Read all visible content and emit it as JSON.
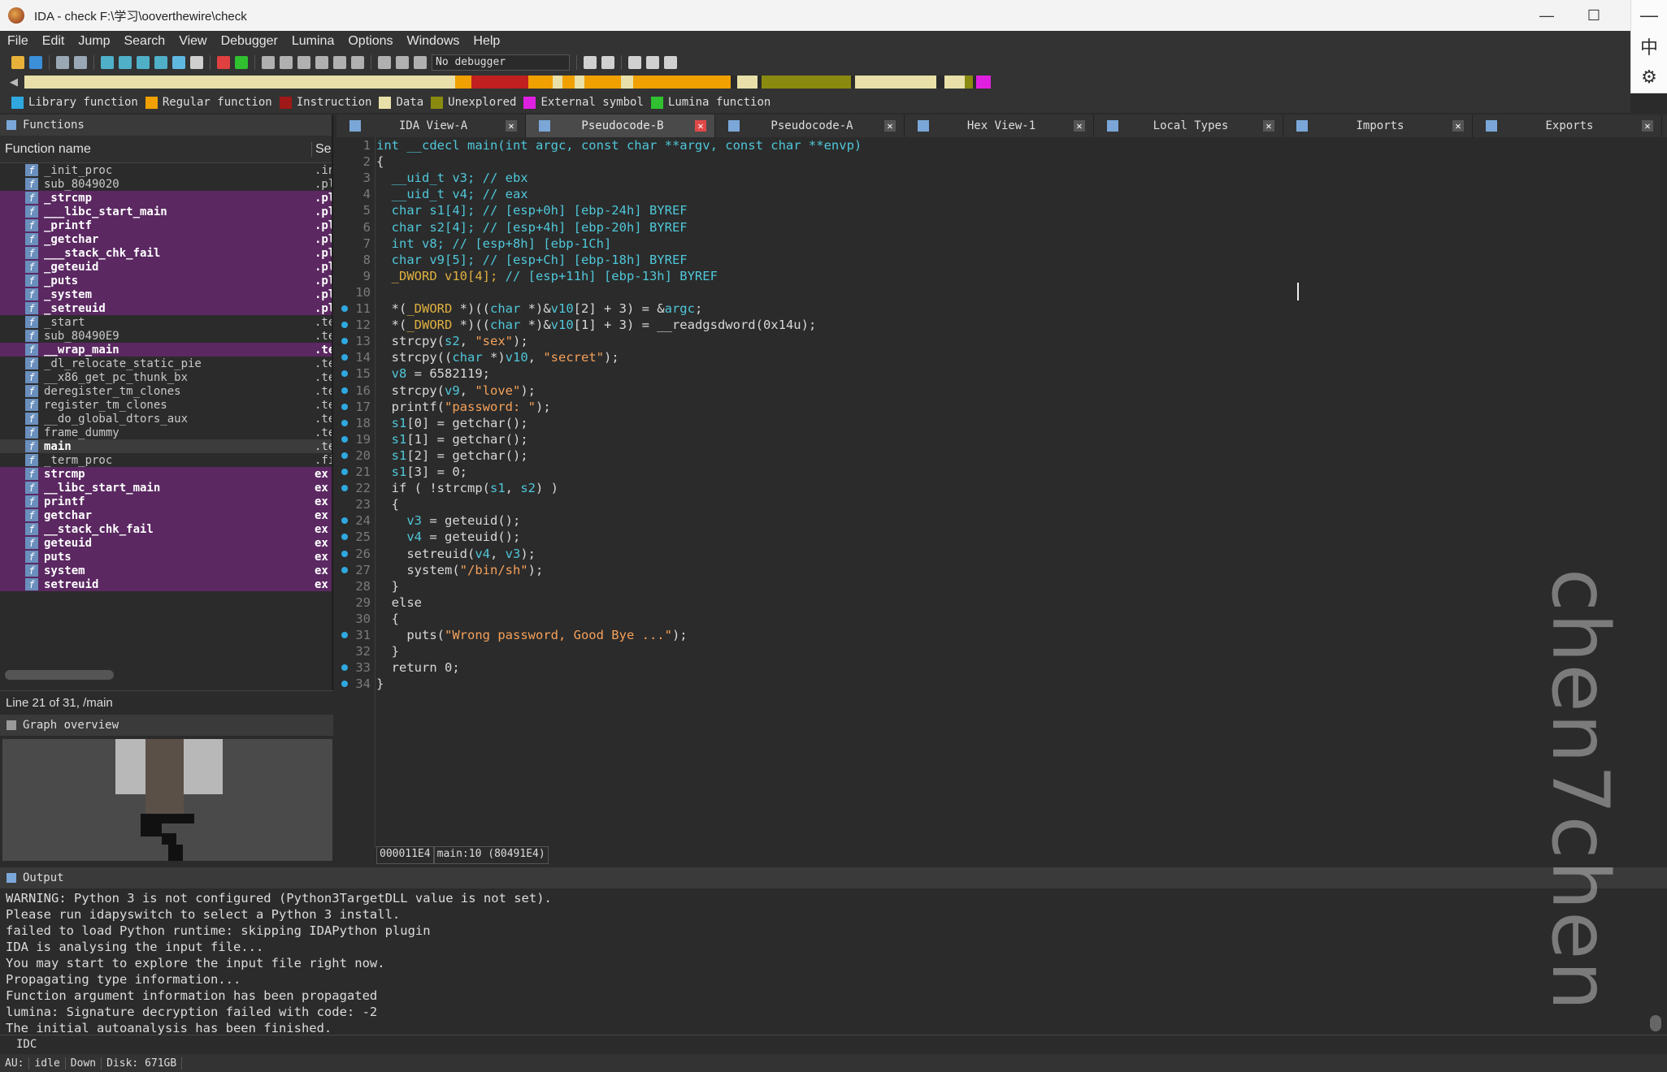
{
  "window": {
    "title": "IDA - check F:\\学习\\ooverthewire\\check",
    "min": "—",
    "max": "☐"
  },
  "ime": {
    "lang": "中",
    "settings": "⚙"
  },
  "menu": [
    "File",
    "Edit",
    "Jump",
    "Search",
    "View",
    "Debugger",
    "Lumina",
    "Options",
    "Windows",
    "Help"
  ],
  "toolbar": {
    "debugger": "No debugger"
  },
  "navband": {
    "segments": [
      {
        "color": "#e8e0a8",
        "w": 530
      },
      {
        "color": "#f0a000",
        "w": 20
      },
      {
        "color": "#c02020",
        "w": 70
      },
      {
        "color": "#f0a000",
        "w": 30
      },
      {
        "color": "#e8e0a8",
        "w": 12
      },
      {
        "color": "#f0a000",
        "w": 15
      },
      {
        "color": "#e8e0a8",
        "w": 12
      },
      {
        "color": "#f0a000",
        "w": 45
      },
      {
        "color": "#e8e0a8",
        "w": 15
      },
      {
        "color": "#f0a000",
        "w": 120
      },
      {
        "color": "#2b2b2b",
        "w": 8
      },
      {
        "color": "#e8e0a8",
        "w": 25
      },
      {
        "color": "#2b2b2b",
        "w": 5
      },
      {
        "color": "#8a8a10",
        "w": 110
      },
      {
        "color": "#2b2b2b",
        "w": 5
      },
      {
        "color": "#e8e0a8",
        "w": 100
      },
      {
        "color": "#2b2b2b",
        "w": 10
      },
      {
        "color": "#e8e0a8",
        "w": 25
      },
      {
        "color": "#8a8a10",
        "w": 10
      },
      {
        "color": "#2b2b2b",
        "w": 4
      },
      {
        "color": "#e020e0",
        "w": 18
      }
    ]
  },
  "legend": [
    {
      "label": "Library function",
      "color": "#2fa8e0"
    },
    {
      "label": "Regular function",
      "color": "#f0a000"
    },
    {
      "label": "Instruction",
      "color": "#a01818"
    },
    {
      "label": "Data",
      "color": "#e8e0a8"
    },
    {
      "label": "Unexplored",
      "color": "#8a8a10"
    },
    {
      "label": "External symbol",
      "color": "#e020e0"
    },
    {
      "label": "Lumina function",
      "color": "#30c030"
    }
  ],
  "functions": {
    "title": "Functions",
    "col_name": "Function name",
    "col_seg": "Se",
    "rows": [
      {
        "name": "_init_proc",
        "seg": ".in",
        "kind": "plain"
      },
      {
        "name": "sub_8049020",
        "seg": ".pl",
        "kind": "plain"
      },
      {
        "name": "_strcmp",
        "seg": ".pl",
        "kind": "lib"
      },
      {
        "name": "___libc_start_main",
        "seg": ".pl",
        "kind": "lib"
      },
      {
        "name": "_printf",
        "seg": ".pl",
        "kind": "lib"
      },
      {
        "name": "_getchar",
        "seg": ".pl",
        "kind": "lib"
      },
      {
        "name": "___stack_chk_fail",
        "seg": ".pl",
        "kind": "lib"
      },
      {
        "name": "_geteuid",
        "seg": ".pl",
        "kind": "lib"
      },
      {
        "name": "_puts",
        "seg": ".pl",
        "kind": "lib"
      },
      {
        "name": "_system",
        "seg": ".pl",
        "kind": "lib"
      },
      {
        "name": "_setreuid",
        "seg": ".pl",
        "kind": "lib"
      },
      {
        "name": "_start",
        "seg": ".te",
        "kind": "plain"
      },
      {
        "name": "sub_80490E9",
        "seg": ".te",
        "kind": "plain"
      },
      {
        "name": "__wrap_main",
        "seg": ".te",
        "kind": "lib"
      },
      {
        "name": "_dl_relocate_static_pie",
        "seg": ".te",
        "kind": "plain"
      },
      {
        "name": "__x86_get_pc_thunk_bx",
        "seg": ".te",
        "kind": "plain"
      },
      {
        "name": "deregister_tm_clones",
        "seg": ".te",
        "kind": "plain"
      },
      {
        "name": "register_tm_clones",
        "seg": ".te",
        "kind": "plain"
      },
      {
        "name": "__do_global_dtors_aux",
        "seg": ".te",
        "kind": "plain"
      },
      {
        "name": "frame_dummy",
        "seg": ".te",
        "kind": "plain"
      },
      {
        "name": "main",
        "seg": ".te",
        "kind": "sel"
      },
      {
        "name": "_term_proc",
        "seg": ".fi",
        "kind": "plain"
      },
      {
        "name": "strcmp",
        "seg": "ex",
        "kind": "lib"
      },
      {
        "name": "__libc_start_main",
        "seg": "ex",
        "kind": "lib"
      },
      {
        "name": "printf",
        "seg": "ex",
        "kind": "lib"
      },
      {
        "name": "getchar",
        "seg": "ex",
        "kind": "lib"
      },
      {
        "name": "__stack_chk_fail",
        "seg": "ex",
        "kind": "lib"
      },
      {
        "name": "geteuid",
        "seg": "ex",
        "kind": "lib"
      },
      {
        "name": "puts",
        "seg": "ex",
        "kind": "lib"
      },
      {
        "name": "system",
        "seg": "ex",
        "kind": "lib"
      },
      {
        "name": "setreuid",
        "seg": "ex",
        "kind": "lib"
      }
    ],
    "status": "Line 21 of 31, /main"
  },
  "graph_overview": {
    "title": "Graph overview"
  },
  "tabs": [
    {
      "label": "IDA View-A",
      "active": false
    },
    {
      "label": "Pseudocode-B",
      "active": true
    },
    {
      "label": "Pseudocode-A",
      "active": false
    },
    {
      "label": "Hex View-1",
      "active": false
    },
    {
      "label": "Local Types",
      "active": false
    },
    {
      "label": "Imports",
      "active": false
    },
    {
      "label": "Exports",
      "active": false
    }
  ],
  "code": {
    "lines": [
      {
        "n": "1",
        "bp": false,
        "parts": [
          [
            "kw",
            "int __cdecl main(int argc, const char **argv, const char **envp)"
          ]
        ]
      },
      {
        "n": "2",
        "bp": false,
        "parts": [
          [
            "pl",
            "{"
          ]
        ]
      },
      {
        "n": "3",
        "bp": false,
        "parts": [
          [
            "kw",
            "  __uid_t v3; // ebx"
          ]
        ]
      },
      {
        "n": "4",
        "bp": false,
        "parts": [
          [
            "kw",
            "  __uid_t v4; // eax"
          ]
        ]
      },
      {
        "n": "5",
        "bp": false,
        "parts": [
          [
            "kw",
            "  char s1[4]; // [esp+0h] [ebp-24h] BYREF"
          ]
        ]
      },
      {
        "n": "6",
        "bp": false,
        "parts": [
          [
            "kw",
            "  char s2[4]; // [esp+4h] [ebp-20h] BYREF"
          ]
        ]
      },
      {
        "n": "7",
        "bp": false,
        "parts": [
          [
            "kw",
            "  int v8; // [esp+8h] [ebp-1Ch]"
          ]
        ]
      },
      {
        "n": "8",
        "bp": false,
        "parts": [
          [
            "kw",
            "  char v9[5]; // [esp+Ch] [ebp-18h] BYREF"
          ]
        ]
      },
      {
        "n": "9",
        "bp": false,
        "parts": [
          [
            "tp",
            "  _DWORD v10[4]; "
          ],
          [
            "cm",
            "// [esp+11h] [ebp-13h] BYREF"
          ]
        ]
      },
      {
        "n": "10",
        "bp": false,
        "parts": [
          [
            "pl",
            ""
          ]
        ]
      },
      {
        "n": "11",
        "bp": true,
        "parts": [
          [
            "pl",
            "  *("
          ],
          [
            "tp",
            "_DWORD"
          ],
          [
            "pl",
            " *)(("
          ],
          [
            "kw",
            "char"
          ],
          [
            "pl",
            " *)&"
          ],
          [
            "kw",
            "v10"
          ],
          [
            "pl",
            "[2] + 3) = &"
          ],
          [
            "kw",
            "argc"
          ],
          [
            "pl",
            ";"
          ]
        ]
      },
      {
        "n": "12",
        "bp": true,
        "parts": [
          [
            "pl",
            "  *("
          ],
          [
            "tp",
            "_DWORD"
          ],
          [
            "pl",
            " *)(("
          ],
          [
            "kw",
            "char"
          ],
          [
            "pl",
            " *)&"
          ],
          [
            "kw",
            "v10"
          ],
          [
            "pl",
            "[1] + 3) = __readgsdword(0x14u);"
          ]
        ]
      },
      {
        "n": "13",
        "bp": true,
        "parts": [
          [
            "pl",
            "  strcpy("
          ],
          [
            "kw",
            "s2"
          ],
          [
            "pl",
            ", "
          ],
          [
            "str",
            "\"sex\""
          ],
          [
            "pl",
            ");"
          ]
        ]
      },
      {
        "n": "14",
        "bp": true,
        "parts": [
          [
            "pl",
            "  strcpy(("
          ],
          [
            "kw",
            "char"
          ],
          [
            "pl",
            " *)"
          ],
          [
            "kw",
            "v10"
          ],
          [
            "pl",
            ", "
          ],
          [
            "str",
            "\"secret\""
          ],
          [
            "pl",
            ");"
          ]
        ]
      },
      {
        "n": "15",
        "bp": true,
        "parts": [
          [
            "kw",
            "  v8"
          ],
          [
            "pl",
            " = 6582119;"
          ]
        ]
      },
      {
        "n": "16",
        "bp": true,
        "parts": [
          [
            "pl",
            "  strcpy("
          ],
          [
            "kw",
            "v9"
          ],
          [
            "pl",
            ", "
          ],
          [
            "str",
            "\"love\""
          ],
          [
            "pl",
            ");"
          ]
        ]
      },
      {
        "n": "17",
        "bp": true,
        "parts": [
          [
            "pl",
            "  printf("
          ],
          [
            "str",
            "\"password: \""
          ],
          [
            "pl",
            ");"
          ]
        ]
      },
      {
        "n": "18",
        "bp": true,
        "parts": [
          [
            "kw",
            "  s1"
          ],
          [
            "pl",
            "[0] = getchar();"
          ]
        ]
      },
      {
        "n": "19",
        "bp": true,
        "parts": [
          [
            "kw",
            "  s1"
          ],
          [
            "pl",
            "[1] = getchar();"
          ]
        ]
      },
      {
        "n": "20",
        "bp": true,
        "parts": [
          [
            "kw",
            "  s1"
          ],
          [
            "pl",
            "[2] = getchar();"
          ]
        ]
      },
      {
        "n": "21",
        "bp": true,
        "parts": [
          [
            "kw",
            "  s1"
          ],
          [
            "pl",
            "[3] = 0;"
          ]
        ]
      },
      {
        "n": "22",
        "bp": true,
        "parts": [
          [
            "pl",
            "  if ( !strcmp("
          ],
          [
            "kw",
            "s1"
          ],
          [
            "pl",
            ", "
          ],
          [
            "kw",
            "s2"
          ],
          [
            "pl",
            ") )"
          ]
        ]
      },
      {
        "n": "23",
        "bp": false,
        "parts": [
          [
            "pl",
            "  {"
          ]
        ]
      },
      {
        "n": "24",
        "bp": true,
        "parts": [
          [
            "kw",
            "    v3"
          ],
          [
            "pl",
            " = geteuid();"
          ]
        ]
      },
      {
        "n": "25",
        "bp": true,
        "parts": [
          [
            "kw",
            "    v4"
          ],
          [
            "pl",
            " = geteuid();"
          ]
        ]
      },
      {
        "n": "26",
        "bp": true,
        "parts": [
          [
            "pl",
            "    setreuid("
          ],
          [
            "kw",
            "v4"
          ],
          [
            "pl",
            ", "
          ],
          [
            "kw",
            "v3"
          ],
          [
            "pl",
            ");"
          ]
        ]
      },
      {
        "n": "27",
        "bp": true,
        "parts": [
          [
            "pl",
            "    system("
          ],
          [
            "str",
            "\"/bin/sh\""
          ],
          [
            "pl",
            ");"
          ]
        ]
      },
      {
        "n": "28",
        "bp": false,
        "parts": [
          [
            "pl",
            "  }"
          ]
        ]
      },
      {
        "n": "29",
        "bp": false,
        "parts": [
          [
            "pl",
            "  else"
          ]
        ]
      },
      {
        "n": "30",
        "bp": false,
        "parts": [
          [
            "pl",
            "  {"
          ]
        ]
      },
      {
        "n": "31",
        "bp": true,
        "parts": [
          [
            "pl",
            "    puts("
          ],
          [
            "str",
            "\"Wrong password, Good Bye ...\""
          ],
          [
            "pl",
            ");"
          ]
        ]
      },
      {
        "n": "32",
        "bp": false,
        "parts": [
          [
            "pl",
            "  }"
          ]
        ]
      },
      {
        "n": "33",
        "bp": true,
        "parts": [
          [
            "pl",
            "  return 0;"
          ]
        ]
      },
      {
        "n": "34",
        "bp": true,
        "parts": [
          [
            "pl",
            "}"
          ]
        ]
      }
    ],
    "status_addr": "000011E4",
    "status_loc": "main:10 (80491E4)"
  },
  "output": {
    "title": "Output",
    "lines": [
      "WARNING: Python 3 is not configured (Python3TargetDLL value is not set).",
      "Please run idapyswitch to select a Python 3 install.",
      "failed to load Python runtime: skipping IDAPython plugin",
      "IDA is analysing the input file...",
      "You may start to explore the input file right now.",
      "Propagating type information...",
      "Function argument information has been propagated",
      "lumina: Signature decryption failed with code: -2",
      "The initial autoanalysis has been finished."
    ],
    "idc": "IDC"
  },
  "statusbar": {
    "au": "AU:",
    "state": "idle",
    "dir": "Down",
    "disk": "Disk: 671GB"
  },
  "watermark": "chen7chen"
}
